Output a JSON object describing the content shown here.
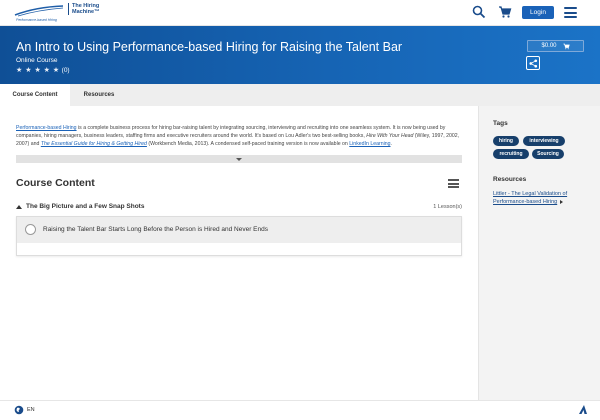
{
  "header": {
    "logo_tagline": "Performance-based Hiring",
    "logo_name": "The Hiring Machine™",
    "login_label": "Login",
    "icons": [
      "search-icon",
      "cart-icon",
      "menu-icon"
    ]
  },
  "course": {
    "title": "An Intro to Using Performance-based Hiring for Raising the Talent Bar",
    "type": "Online Course",
    "stars": "★ ★ ★ ★ ★",
    "rating_count": "(0)",
    "price": "$0.00"
  },
  "tabs": [
    {
      "label": "Course Content",
      "active": true
    },
    {
      "label": "Resources",
      "active": false
    }
  ],
  "description": {
    "link1": "Performance-based Hiring",
    "text1": " is a complete business process for hiring bar-raising talent by integrating sourcing, interviewing and recruiting into one seamless system. It is now being used by companies, hiring managers, business leaders, staffing firms and executive recruiters around the world. It's based on Lou Adler's two best-selling books, ",
    "book1": "Hire With Your Head",
    "text2": " (Wiley, 1997, 2002, 2007) and ",
    "book2": "The Essential Guide for Hiring & Getting Hired",
    "text3": " (Workbench Media, 2013). A condensed self-paced training version is now available on ",
    "link2": "LinkedIn Learning",
    "text4": "."
  },
  "content": {
    "heading": "Course Content",
    "chapter_title": "The Big Picture and a Few Snap Shots",
    "chapter_count": "1 Lesson(s)",
    "lesson_title": "Raising the Talent Bar Starts Long Before the Person is Hired and Never Ends"
  },
  "sidebar": {
    "tags_title": "Tags",
    "tags": [
      "hiring",
      "interviewing",
      "recruiting",
      "Sourcing"
    ],
    "resources_title": "Resources",
    "resource_link": "Littler - The Legal Validation of Performance-based Hiring"
  },
  "footer": {
    "language": "EN"
  },
  "colors": {
    "hero_blue": "#1664b4",
    "login_blue": "#1a62b8",
    "tag_navy": "#173f6b"
  }
}
